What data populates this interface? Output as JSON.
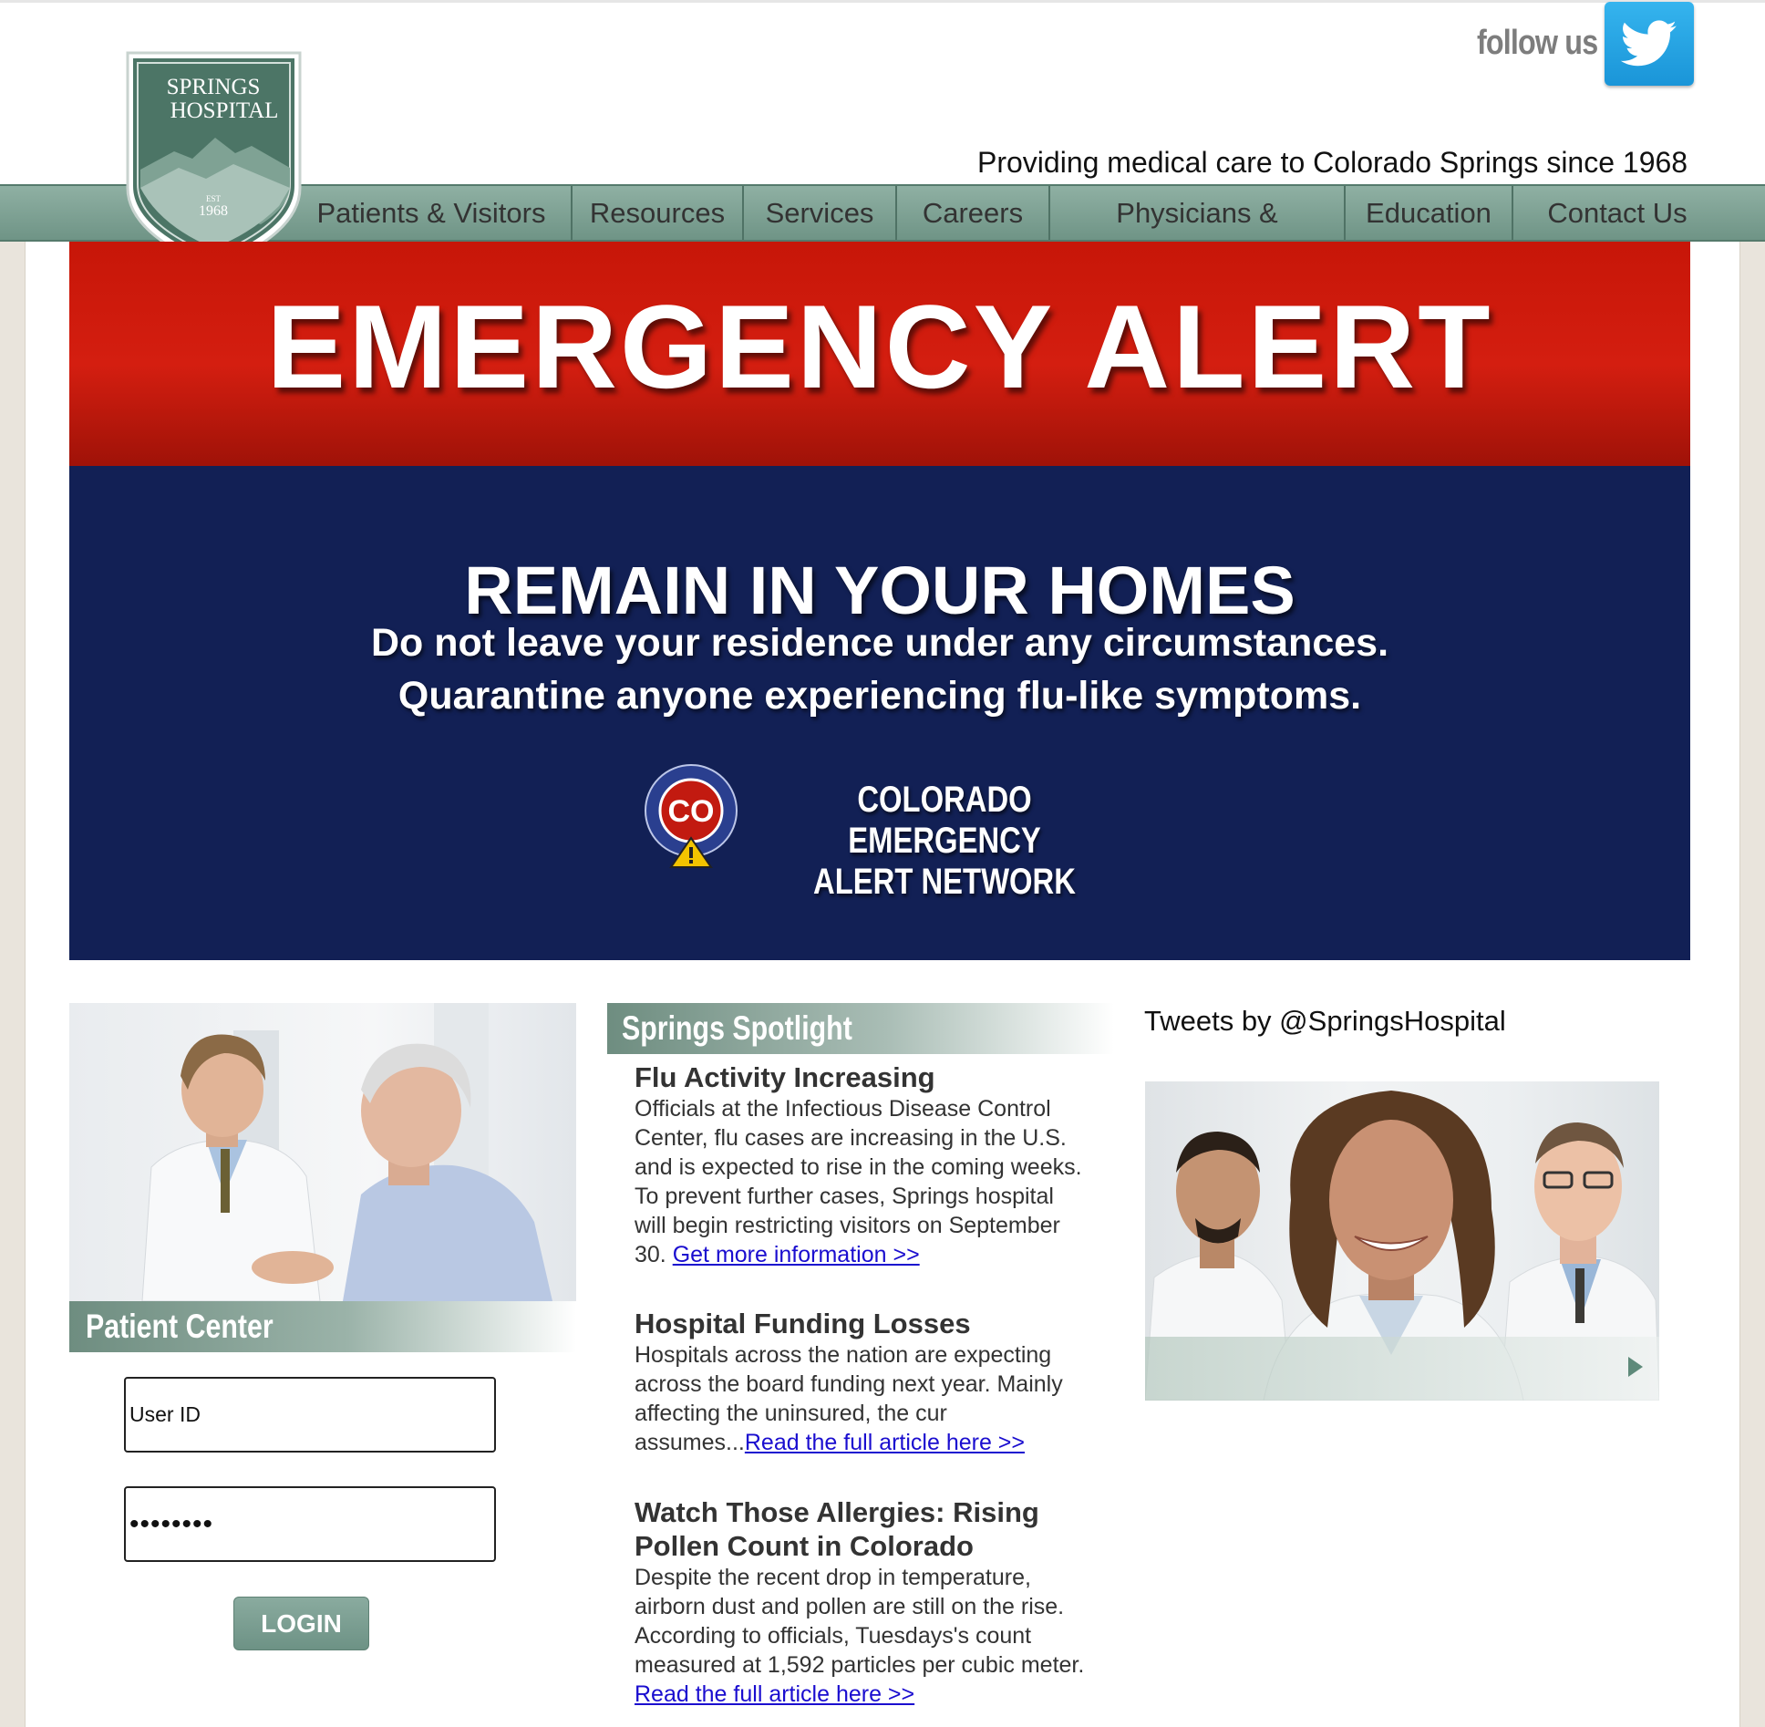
{
  "header": {
    "follow_label": "follow us",
    "tagline": "Providing medical care to Colorado Springs since 1968",
    "logo": {
      "line1": "SPRINGS",
      "line2": "HOSPITAL",
      "est": "EST",
      "year": "1968"
    }
  },
  "nav": {
    "items": [
      {
        "label": "Patients & Visitors"
      },
      {
        "label": "Resources"
      },
      {
        "label": "Services"
      },
      {
        "label": "Careers"
      },
      {
        "label": "Physicians & Residents"
      },
      {
        "label": "Education"
      },
      {
        "label": "Contact Us"
      }
    ]
  },
  "alert": {
    "title": "EMERGENCY ALERT",
    "headline": "REMAIN IN YOUR HOMES",
    "line1": "Do not leave your residence under any circumstances.",
    "line2": "Quarantine anyone experiencing flu-like symptoms.",
    "network_line1": "COLORADO EMERGENCY",
    "network_line2": "ALERT NETWORK",
    "badge_code": "CO",
    "badge_ring": "COLORADO EMERGENCY ALERT NETWORK"
  },
  "patient_center": {
    "label": "Patient Center",
    "user_id_value": "User ID",
    "password_value": "••••••••",
    "login_label": "LOGIN"
  },
  "spotlight": {
    "label": "Springs Spotlight",
    "articles": [
      {
        "title": "Flu Activity Increasing",
        "body": "Officials at the Infectious Disease Control Center, flu cases are increasing in the U.S. and is expected to rise in the coming weeks. To prevent further cases, Springs hospital will begin restricting visitors on September 30. ",
        "link": "Get more information >>"
      },
      {
        "title": "Hospital Funding Losses",
        "body": "Hospitals across the nation are expecting across the board funding next year. Mainly affecting the uninsured, the cur assumes...",
        "link": "Read the full article here >>"
      },
      {
        "title": "Watch Those Allergies: Rising Pollen Count in Colorado",
        "body": "Despite the recent drop in temperature, airborn dust and pollen are still on the rise. According to officials, Tuesdays's count measured at 1,592 particles per cubic meter. ",
        "link": "Read the full article here >>"
      }
    ]
  },
  "tweets": {
    "heading": "Tweets by @SpringsHospital"
  },
  "colors": {
    "nav_green": "#7fa294",
    "alert_red": "#cc1a0c",
    "alert_blue": "#122055",
    "twitter_blue": "#1da1f2",
    "link_blue": "#1a0dcf"
  }
}
